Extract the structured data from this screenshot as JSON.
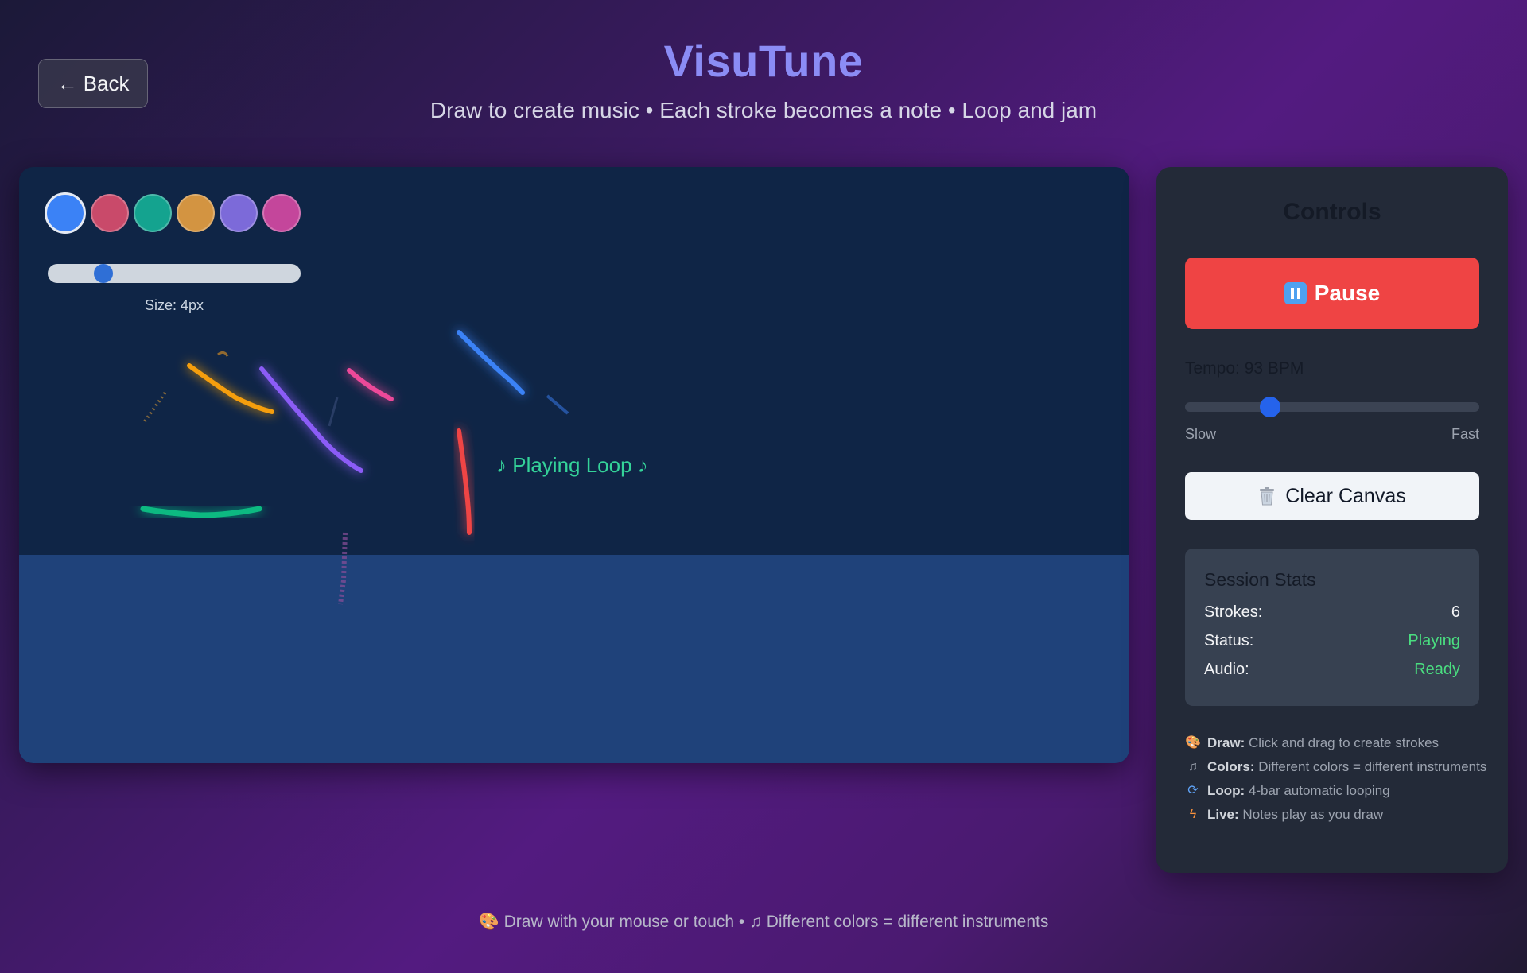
{
  "header": {
    "back_label": "← Back",
    "title": "VisuTune",
    "subtitle": "Draw to create music • Each stroke becomes a note • Loop and jam"
  },
  "canvas": {
    "palette": [
      {
        "name": "blue",
        "color": "#3b82f6",
        "selected": true
      },
      {
        "name": "red",
        "color": "#c94a6a",
        "selected": false
      },
      {
        "name": "teal",
        "color": "#14a38f",
        "selected": false
      },
      {
        "name": "orange",
        "color": "#d39441",
        "selected": false
      },
      {
        "name": "purple",
        "color": "#7c6ad9",
        "selected": false
      },
      {
        "name": "pink",
        "color": "#c4469b",
        "selected": false
      }
    ],
    "size_label": "Size: 4px",
    "size_value": 4,
    "playing_label": "♪ Playing Loop ♪"
  },
  "controls": {
    "title": "Controls",
    "pause_label": "Pause",
    "tempo_label": "Tempo: 93 BPM",
    "tempo_bpm": 93,
    "tempo_slow": "Slow",
    "tempo_fast": "Fast",
    "clear_label": "Clear Canvas",
    "stats": {
      "title": "Session Stats",
      "strokes_key": "Strokes:",
      "strokes_val": "6",
      "status_key": "Status:",
      "status_val": "Playing",
      "audio_key": "Audio:",
      "audio_val": "Ready"
    },
    "help": [
      {
        "icon": "palette-icon",
        "bold": "Draw:",
        "text": "Click and drag to create strokes"
      },
      {
        "icon": "music-notes-icon",
        "bold": "Colors:",
        "text": "Different colors = different instruments"
      },
      {
        "icon": "loop-icon",
        "bold": "Loop:",
        "text": "4-bar automatic looping"
      },
      {
        "icon": "lightning-icon",
        "bold": "Live:",
        "text": "Notes play as you draw"
      }
    ]
  },
  "footer": {
    "part1": "Draw with your mouse or touch •",
    "part2": "Different colors = different instruments"
  },
  "colors": {
    "accent_title": "#8b8cf5",
    "pause_red": "#ef4444",
    "status_green": "#4ade80",
    "playing_green": "#34d399"
  }
}
